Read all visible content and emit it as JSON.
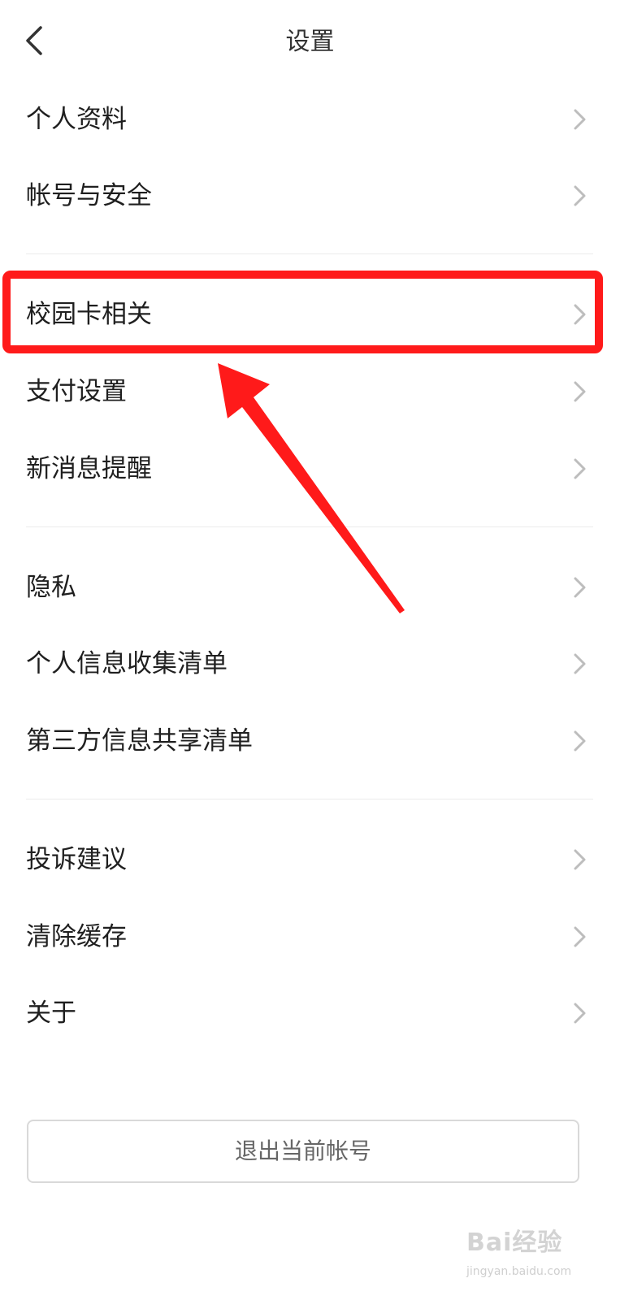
{
  "header": {
    "title": "设置"
  },
  "menu": [
    {
      "label": "个人资料"
    },
    {
      "label": "帐号与安全"
    },
    {
      "label": "校园卡相关"
    },
    {
      "label": "支付设置"
    },
    {
      "label": "新消息提醒"
    },
    {
      "label": "隐私"
    },
    {
      "label": "个人信息收集清单"
    },
    {
      "label": "第三方信息共享清单"
    },
    {
      "label": "投诉建议"
    },
    {
      "label": "清除缓存"
    },
    {
      "label": "关于"
    }
  ],
  "logout": {
    "label": "退出当前帐号"
  },
  "watermark": {
    "brand": "Bai经验",
    "url": "jingyan.baidu.com"
  },
  "icons": {
    "back": "chevron-left-icon",
    "row": "chevron-right-icon"
  },
  "colors": {
    "annotation": "#ff1a1a",
    "text": "#1f1f1f",
    "divider": "#ececec",
    "chevron": "#bdbdbd"
  }
}
